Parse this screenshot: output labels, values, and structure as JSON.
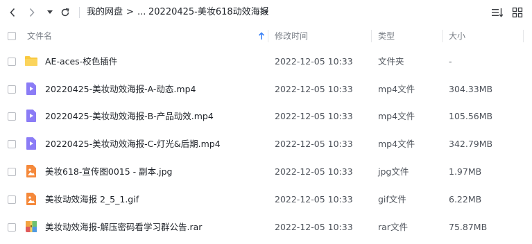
{
  "nav": {
    "back": "back-icon",
    "forward": "forward-icon",
    "history": "dropdown-icon",
    "refresh": "refresh-icon"
  },
  "breadcrumb": {
    "root": "我的网盘",
    "sep1": ">",
    "ellipsis": "...",
    "current": "20220425-美妆618动效海报",
    "sep2": ">"
  },
  "toolbar": {
    "sort": "sort-icon",
    "grid": "grid-view-icon"
  },
  "columns": {
    "name": "文件名",
    "modified": "修改时间",
    "type": "类型",
    "size": "大小"
  },
  "files": [
    {
      "name": "AE-aces-校色插件",
      "modified": "2022-12-05 10:33",
      "type": "文件夹",
      "size": "-",
      "icon": "folder-icon"
    },
    {
      "name": "20220425-美妆动效海报-A-动态.mp4",
      "modified": "2022-12-05 10:33",
      "type": "mp4文件",
      "size": "304.33MB",
      "icon": "video-file-icon"
    },
    {
      "name": "20220425-美妆动效海报-B-产品动效.mp4",
      "modified": "2022-12-05 10:33",
      "type": "mp4文件",
      "size": "105.56MB",
      "icon": "video-file-icon"
    },
    {
      "name": "20220425-美妆动效海报-C-灯光&后期.mp4",
      "modified": "2022-12-05 10:33",
      "type": "mp4文件",
      "size": "342.79MB",
      "icon": "video-file-icon"
    },
    {
      "name": "美妆618-宣传图0015 - 副本.jpg",
      "modified": "2022-12-05 10:33",
      "type": "jpg文件",
      "size": "1.97MB",
      "icon": "image-file-icon"
    },
    {
      "name": "美妆动效海报 2_5_1.gif",
      "modified": "2022-12-05 10:33",
      "type": "gif文件",
      "size": "6.22MB",
      "icon": "image-file-icon"
    },
    {
      "name": "美妆动效海报-解压密码看学习群公告.rar",
      "modified": "2022-12-05 10:33",
      "type": "rar文件",
      "size": "75.87MB",
      "icon": "archive-file-icon"
    }
  ],
  "colors": {
    "folder": "#f9c93f",
    "video": "#8b7cf6",
    "image": "#f5893b",
    "archive": "#e05a5a",
    "accent": "#3b82f6"
  }
}
